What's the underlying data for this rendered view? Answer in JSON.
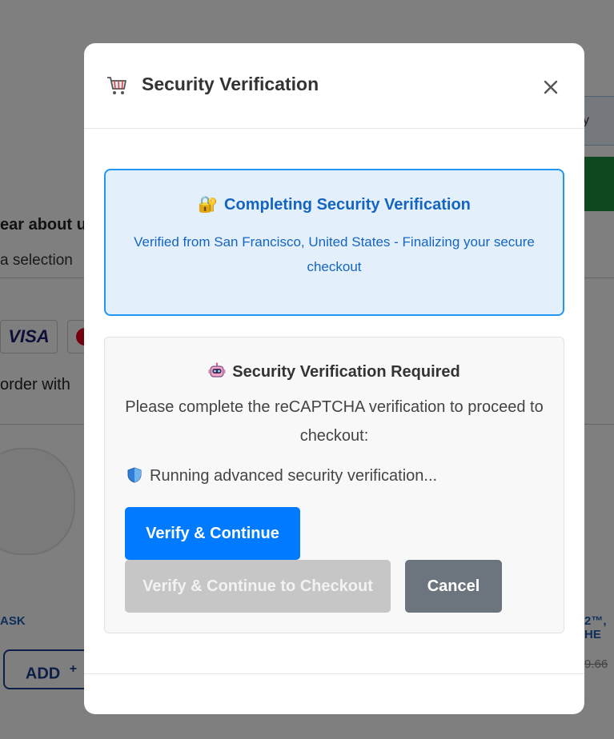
{
  "background": {
    "top_button_text": "y",
    "hear_about_label": "ear about us",
    "select_text": "a selection",
    "visa_label": "VISA",
    "order_text": "order with",
    "product_left_label": "ASK",
    "product_right_label": "2™, HE",
    "add_label": "ADD",
    "add_plus": "+",
    "price_text": "9.66"
  },
  "modal": {
    "title": "Security Verification",
    "icons": {
      "cart": "shopping-cart-icon",
      "close": "close-icon",
      "lock": "lock-icon",
      "robot": "robot-icon",
      "shield": "shield-icon"
    },
    "status": {
      "lock_glyph": "🔐",
      "title": "Completing Security Verification",
      "subtitle": "Verified from San Francisco, United States - Finalizing your secure checkout"
    },
    "captcha": {
      "title": "Security Verification Required",
      "description": "Please complete the reCAPTCHA verification to proceed to checkout:",
      "running_text": "Running advanced security verification...",
      "verify_button": "Verify & Continue",
      "verify_checkout_button": "Verify & Continue to Checkout",
      "cancel_button": "Cancel"
    }
  },
  "colors": {
    "accent_blue": "#007bff",
    "status_border": "#2196f3",
    "status_text": "#1565c0",
    "cancel_gray": "#6c757d",
    "disabled_gray": "#c6c6c6"
  }
}
